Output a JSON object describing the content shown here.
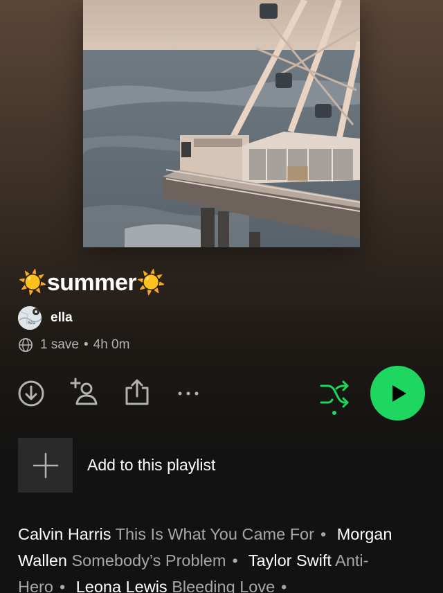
{
  "playlist": {
    "title": "☀️summer☀️",
    "owner": "ella",
    "avatar_text": "Rea",
    "saves": "1 save",
    "separator": "•",
    "duration": "4h 0m"
  },
  "actions": {
    "download_icon": "download-icon",
    "add_user_icon": "add-user-icon",
    "share_icon": "share-icon",
    "more_icon": "more-icon",
    "shuffle_icon": "shuffle-icon",
    "play_icon": "play-icon"
  },
  "add_to_playlist": {
    "label": "Add to this playlist"
  },
  "featured": [
    {
      "artist": "Calvin Harris",
      "song": "This Is What You Came For"
    },
    {
      "artist": "Morgan Wallen",
      "song": "Somebody’s Problem"
    },
    {
      "artist": "Taylor Swift",
      "song": "Anti-Hero"
    },
    {
      "artist": "Leona Lewis",
      "song": "Bleeding Love"
    }
  ],
  "colors": {
    "accent": "#1ed760",
    "background": "#121212",
    "secondary_text": "#a7a7a7"
  }
}
